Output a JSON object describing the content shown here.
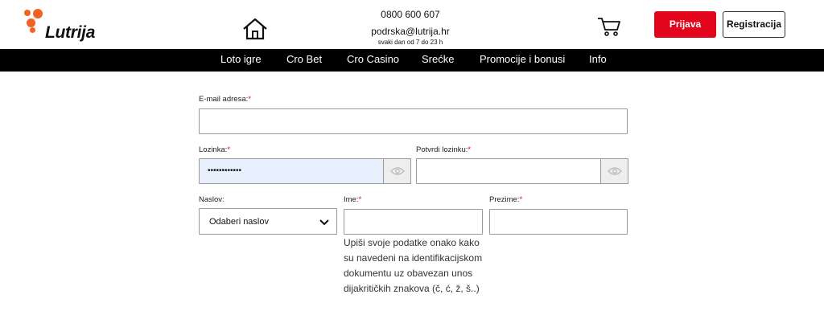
{
  "header": {
    "logo_text": "Lutrija",
    "contact": {
      "phone": "0800 600 607",
      "email": "podrska@lutrija.hr",
      "hours": "svaki dan od 7 do 23 h"
    },
    "login_label": "Prijava",
    "register_label": "Registracija",
    "icons": {
      "home": "home-icon",
      "cart": "cart-icon"
    },
    "colors": {
      "accent": "#e3051b",
      "logo_orange": "#f26322"
    }
  },
  "nav": {
    "items": [
      "Loto igre",
      "Cro Bet",
      "Cro Casino",
      "Srećke",
      "Promocije i bonusi",
      "Info"
    ]
  },
  "form": {
    "email": {
      "label": "E-mail adresa:",
      "required": "*",
      "value": ""
    },
    "password": {
      "label": "Lozinka:",
      "required": "*",
      "value": "••••••••••••"
    },
    "confirm_password": {
      "label": "Potvrdi lozinku:",
      "required": "*",
      "value": ""
    },
    "title": {
      "label": "Naslov:",
      "selected": "Odaberi naslov"
    },
    "first_name": {
      "label": "Ime:",
      "required": "*",
      "value": ""
    },
    "last_name": {
      "label": "Prezime:",
      "required": "*",
      "value": ""
    },
    "name_hint": "Upiši svoje podatke onako kako su navedeni na identifikacijskom dokumentu uz obavezan unos dijakritičkih znakova (č, ć, ž, š..)"
  }
}
